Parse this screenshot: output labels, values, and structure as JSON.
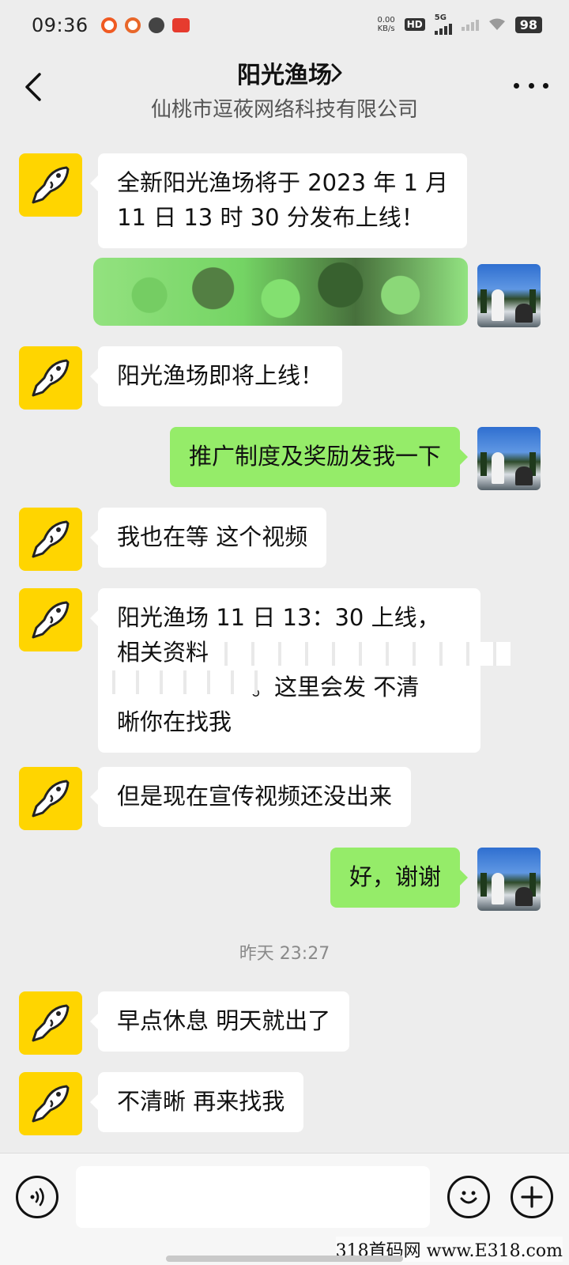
{
  "status_bar": {
    "time": "09:36",
    "net_speed_value": "0.00",
    "net_speed_unit": "KB/s",
    "hd_label": "HD",
    "network_type": "5G",
    "battery": "98"
  },
  "header": {
    "title": "阳光渔场",
    "subtitle": "仙桃市逗莜网络科技有限公司"
  },
  "messages": [
    {
      "side": "left",
      "lines": [
        "全新阳光渔场将于 2023 年 1 月",
        "11 日 13 时 30 分发布上线！"
      ]
    },
    {
      "side": "right",
      "lines": [
        ""
      ],
      "redacted": true
    },
    {
      "side": "left",
      "lines": [
        "阳光渔场即将上线！"
      ]
    },
    {
      "side": "right",
      "lines": [
        "推广制度及奖励发我一下"
      ]
    },
    {
      "side": "left",
      "lines": [
        "我也在等 这个视频"
      ]
    },
    {
      "side": "left",
      "lines": [
        "阳光渔场 11 日 13：30 上线，",
        "相关资料",
        "。这里会发 不清",
        "晰你在找我"
      ]
    },
    {
      "side": "left",
      "lines": [
        "但是现在宣传视频还没出来"
      ]
    },
    {
      "side": "right",
      "lines": [
        "好，谢谢"
      ]
    },
    {
      "side": "left",
      "lines": [
        "早点休息 明天就出了"
      ]
    },
    {
      "side": "left",
      "lines": [
        "不清晰 再来找我"
      ]
    }
  ],
  "time_divider": "昨天 23:27",
  "input": {
    "value": "",
    "placeholder": ""
  },
  "watermark": "318首码网 www.E318.com",
  "colors": {
    "background": "#ededed",
    "bubble_self": "#95ec69",
    "bubble_other": "#ffffff",
    "bot_avatar": "#ffd500"
  }
}
